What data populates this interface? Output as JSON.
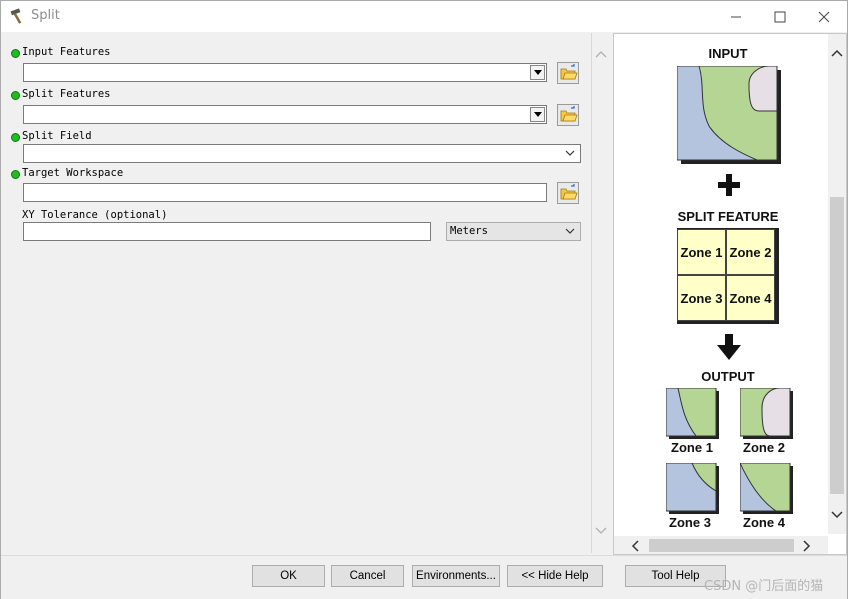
{
  "window": {
    "title": "Split"
  },
  "form": {
    "input_features_label": "Input Features",
    "split_features_label": "Split Features",
    "split_field_label": "Split Field",
    "target_workspace_label": "Target Workspace",
    "xy_tolerance_label": "XY Tolerance (optional)",
    "xy_tolerance_unit": "Meters"
  },
  "help": {
    "input_title": "INPUT",
    "split_feature_title": "SPLIT FEATURE",
    "output_title": "OUTPUT",
    "zones": [
      "Zone 1",
      "Zone 2",
      "Zone 3",
      "Zone 4"
    ]
  },
  "buttons": {
    "ok": "OK",
    "cancel": "Cancel",
    "environments": "Environments...",
    "hide_help": "<< Hide Help",
    "tool_help": "Tool Help"
  },
  "watermark": "CSDN @门后面的猫",
  "colors": {
    "water": "#b4c3de",
    "land": "#b5d594",
    "zone_fill": "#ffffc8",
    "required_dot": "#22bb22"
  }
}
